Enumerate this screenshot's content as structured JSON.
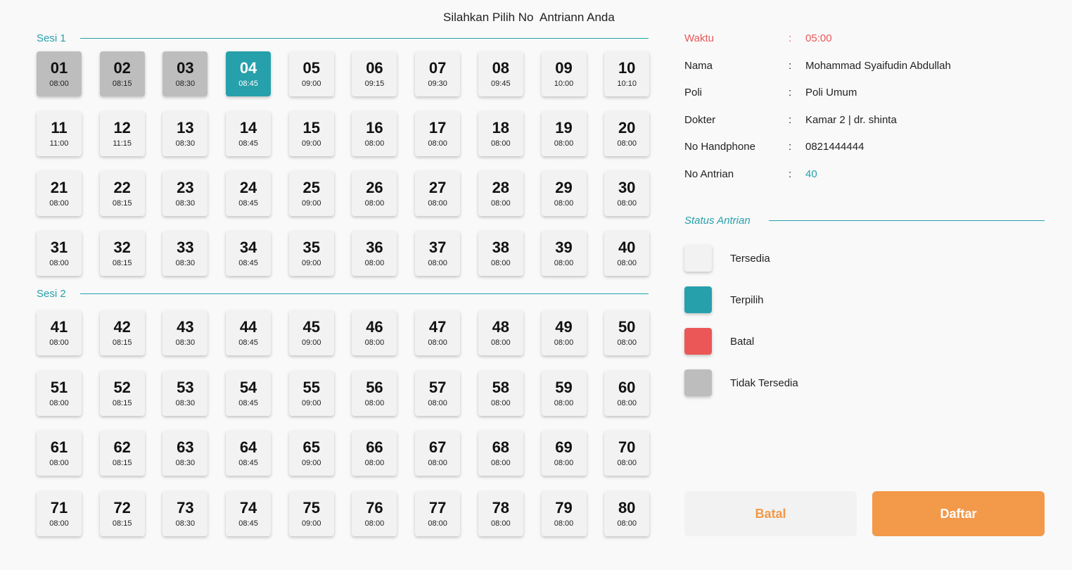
{
  "header": {
    "title": "Silahkan Pilih No  Antriann Anda"
  },
  "colors": {
    "accent": "#26a0ab",
    "available": "#f2f2f2",
    "selected": "#26a0ab",
    "cancelled": "#eb5757",
    "unavailable": "#bdbdbd",
    "primary_button": "#f2994a"
  },
  "sessions": [
    {
      "label": "Sesi 1",
      "slots": [
        {
          "no": "01",
          "time": "08:00",
          "state": "disabled"
        },
        {
          "no": "02",
          "time": "08:15",
          "state": "disabled"
        },
        {
          "no": "03",
          "time": "08:30",
          "state": "disabled"
        },
        {
          "no": "04",
          "time": "08:45",
          "state": "selected"
        },
        {
          "no": "05",
          "time": "09:00",
          "state": "available"
        },
        {
          "no": "06",
          "time": "09:15",
          "state": "available"
        },
        {
          "no": "07",
          "time": "09:30",
          "state": "available"
        },
        {
          "no": "08",
          "time": "09:45",
          "state": "available"
        },
        {
          "no": "09",
          "time": "10:00",
          "state": "available"
        },
        {
          "no": "10",
          "time": "10:10",
          "state": "available"
        },
        {
          "no": "11",
          "time": "11:00",
          "state": "available"
        },
        {
          "no": "12",
          "time": "11:15",
          "state": "available"
        },
        {
          "no": "13",
          "time": "08:30",
          "state": "available"
        },
        {
          "no": "14",
          "time": "08:45",
          "state": "available"
        },
        {
          "no": "15",
          "time": "09:00",
          "state": "available"
        },
        {
          "no": "16",
          "time": "08:00",
          "state": "available"
        },
        {
          "no": "17",
          "time": "08:00",
          "state": "available"
        },
        {
          "no": "18",
          "time": "08:00",
          "state": "available"
        },
        {
          "no": "19",
          "time": "08:00",
          "state": "available"
        },
        {
          "no": "20",
          "time": "08:00",
          "state": "available"
        },
        {
          "no": "21",
          "time": "08:00",
          "state": "available"
        },
        {
          "no": "22",
          "time": "08:15",
          "state": "available"
        },
        {
          "no": "23",
          "time": "08:30",
          "state": "available"
        },
        {
          "no": "24",
          "time": "08:45",
          "state": "available"
        },
        {
          "no": "25",
          "time": "09:00",
          "state": "available"
        },
        {
          "no": "26",
          "time": "08:00",
          "state": "available"
        },
        {
          "no": "27",
          "time": "08:00",
          "state": "available"
        },
        {
          "no": "28",
          "time": "08:00",
          "state": "available"
        },
        {
          "no": "29",
          "time": "08:00",
          "state": "available"
        },
        {
          "no": "30",
          "time": "08:00",
          "state": "available"
        },
        {
          "no": "31",
          "time": "08:00",
          "state": "available"
        },
        {
          "no": "32",
          "time": "08:15",
          "state": "available"
        },
        {
          "no": "33",
          "time": "08:30",
          "state": "available"
        },
        {
          "no": "34",
          "time": "08:45",
          "state": "available"
        },
        {
          "no": "35",
          "time": "09:00",
          "state": "available"
        },
        {
          "no": "36",
          "time": "08:00",
          "state": "available"
        },
        {
          "no": "37",
          "time": "08:00",
          "state": "available"
        },
        {
          "no": "38",
          "time": "08:00",
          "state": "available"
        },
        {
          "no": "39",
          "time": "08:00",
          "state": "available"
        },
        {
          "no": "40",
          "time": "08:00",
          "state": "available"
        }
      ]
    },
    {
      "label": "Sesi 2",
      "slots": [
        {
          "no": "41",
          "time": "08:00",
          "state": "available"
        },
        {
          "no": "42",
          "time": "08:15",
          "state": "available"
        },
        {
          "no": "43",
          "time": "08:30",
          "state": "available"
        },
        {
          "no": "44",
          "time": "08:45",
          "state": "available"
        },
        {
          "no": "45",
          "time": "09:00",
          "state": "available"
        },
        {
          "no": "46",
          "time": "08:00",
          "state": "available"
        },
        {
          "no": "47",
          "time": "08:00",
          "state": "available"
        },
        {
          "no": "48",
          "time": "08:00",
          "state": "available"
        },
        {
          "no": "49",
          "time": "08:00",
          "state": "available"
        },
        {
          "no": "50",
          "time": "08:00",
          "state": "available"
        },
        {
          "no": "51",
          "time": "08:00",
          "state": "available"
        },
        {
          "no": "52",
          "time": "08:15",
          "state": "available"
        },
        {
          "no": "53",
          "time": "08:30",
          "state": "available"
        },
        {
          "no": "54",
          "time": "08:45",
          "state": "available"
        },
        {
          "no": "55",
          "time": "09:00",
          "state": "available"
        },
        {
          "no": "56",
          "time": "08:00",
          "state": "available"
        },
        {
          "no": "57",
          "time": "08:00",
          "state": "available"
        },
        {
          "no": "58",
          "time": "08:00",
          "state": "available"
        },
        {
          "no": "59",
          "time": "08:00",
          "state": "available"
        },
        {
          "no": "60",
          "time": "08:00",
          "state": "available"
        },
        {
          "no": "61",
          "time": "08:00",
          "state": "available"
        },
        {
          "no": "62",
          "time": "08:15",
          "state": "available"
        },
        {
          "no": "63",
          "time": "08:30",
          "state": "available"
        },
        {
          "no": "64",
          "time": "08:45",
          "state": "available"
        },
        {
          "no": "65",
          "time": "09:00",
          "state": "available"
        },
        {
          "no": "66",
          "time": "08:00",
          "state": "available"
        },
        {
          "no": "67",
          "time": "08:00",
          "state": "available"
        },
        {
          "no": "68",
          "time": "08:00",
          "state": "available"
        },
        {
          "no": "69",
          "time": "08:00",
          "state": "available"
        },
        {
          "no": "70",
          "time": "08:00",
          "state": "available"
        },
        {
          "no": "71",
          "time": "08:00",
          "state": "available"
        },
        {
          "no": "72",
          "time": "08:15",
          "state": "available"
        },
        {
          "no": "73",
          "time": "08:30",
          "state": "available"
        },
        {
          "no": "74",
          "time": "08:45",
          "state": "available"
        },
        {
          "no": "75",
          "time": "09:00",
          "state": "available"
        },
        {
          "no": "76",
          "time": "08:00",
          "state": "available"
        },
        {
          "no": "77",
          "time": "08:00",
          "state": "available"
        },
        {
          "no": "78",
          "time": "08:00",
          "state": "available"
        },
        {
          "no": "79",
          "time": "08:00",
          "state": "available"
        },
        {
          "no": "80",
          "time": "08:00",
          "state": "available"
        }
      ]
    }
  ],
  "info": {
    "separator": ":",
    "rows": [
      {
        "label": "Waktu",
        "value": "05:00"
      },
      {
        "label": "Nama",
        "value": "Mohammad Syaifudin Abdullah"
      },
      {
        "label": "Poli",
        "value": "Poli Umum"
      },
      {
        "label": "Dokter",
        "value": "Kamar 2 | dr. shinta"
      },
      {
        "label": "No Handphone",
        "value": "0821444444"
      },
      {
        "label": "No Antrian",
        "value": "40"
      }
    ]
  },
  "status": {
    "title": "Status Antrian",
    "legend": [
      {
        "label": "Tersedia",
        "color": "#f2f2f2"
      },
      {
        "label": "Terpilih",
        "color": "#26a0ab"
      },
      {
        "label": "Batal",
        "color": "#eb5757"
      },
      {
        "label": "Tidak Tersedia",
        "color": "#bdbdbd"
      }
    ]
  },
  "actions": {
    "cancel_label": "Batal",
    "submit_label": "Daftar"
  }
}
